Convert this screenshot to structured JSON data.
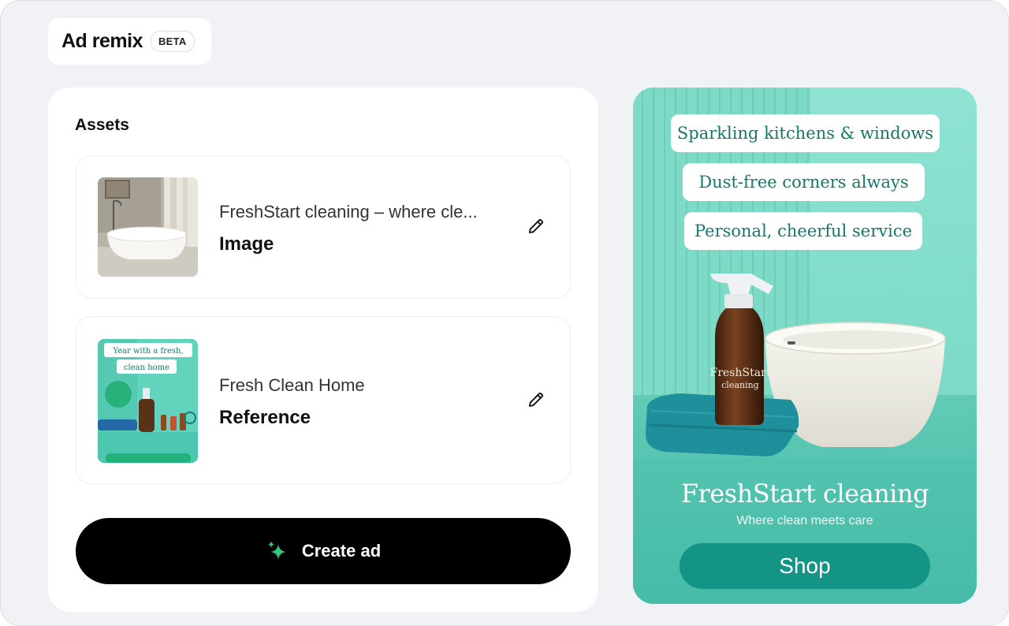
{
  "header": {
    "title": "Ad remix",
    "badge": "BETA"
  },
  "assets": {
    "title": "Assets",
    "items": [
      {
        "name": "FreshStart cleaning – where cle...",
        "type": "Image",
        "thumbnail": "bathtub-photo"
      },
      {
        "name": "Fresh Clean Home",
        "type": "Reference",
        "thumbnail": "reference-ad"
      }
    ],
    "reference_thumb_text": {
      "line1": "Year with a fresh,",
      "line2": "clean home"
    }
  },
  "actions": {
    "create_label": "Create ad"
  },
  "ad": {
    "pills": [
      "Sparkling kitchens & windows",
      "Dust-free corners always",
      "Personal, cheerful service"
    ],
    "bottle_brand": "FreshStart",
    "bottle_sub": "cleaning",
    "brand": "FreshStart cleaning",
    "tagline": "Where clean meets care",
    "cta": "Shop"
  },
  "colors": {
    "accent_teal": "#149484",
    "ad_background": "#8fe0d0",
    "sparkle": "#2ec97a",
    "button_black": "#000000"
  }
}
